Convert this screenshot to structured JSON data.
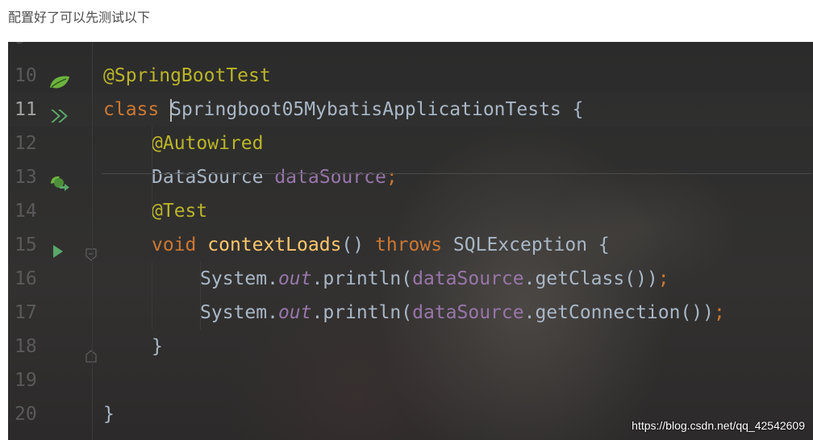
{
  "caption": "配置好了可以先测试以下",
  "watermark": "https://blog.csdn.net/qq_42542609",
  "colors": {
    "editor_bg": "#2b2b2b",
    "annotation": "#bbb529",
    "keyword": "#cc7832",
    "field": "#9876aa",
    "method": "#ffc66d",
    "text": "#a9b7c6",
    "run_icon": "#59a869"
  },
  "editor": {
    "lines": [
      {
        "num": "10",
        "icon": "spring-leaf-icon"
      },
      {
        "num": "11",
        "icon": "run-tests-icon"
      },
      {
        "num": "12"
      },
      {
        "num": "13",
        "icon": "autowired-bean-icon"
      },
      {
        "num": "14"
      },
      {
        "num": "15",
        "icon": "run-test-icon"
      },
      {
        "num": "16"
      },
      {
        "num": "17"
      },
      {
        "num": "18"
      },
      {
        "num": "19"
      },
      {
        "num": "20"
      }
    ],
    "tokens": {
      "l10_annot": "@SpringBootTest",
      "l11_kw": "class ",
      "l11_cls_first": "S",
      "l11_cls_rest": "pringboot05MybatisApplicationTests",
      "l11_brace": " {",
      "l12_annot": "@Autowired",
      "l13_type": "DataSource ",
      "l13_field": "dataSource",
      "l13_semi": ";",
      "l14_annot": "@Test",
      "l15_void": "void ",
      "l15_method": "contextLoads",
      "l15_parens": "() ",
      "l15_throws": "throws ",
      "l15_exc": "SQLException {",
      "l16_sys": "System.",
      "l16_out": "out",
      "l16_call": ".println(",
      "l16_field": "dataSource",
      "l16_rest": ".getClass())",
      "l16_semi": ";",
      "l17_sys": "System.",
      "l17_out": "out",
      "l17_call": ".println(",
      "l17_field": "dataSource",
      "l17_rest": ".getConnection())",
      "l17_semi": ";",
      "l18_close": "}",
      "l20_close": "}"
    }
  }
}
